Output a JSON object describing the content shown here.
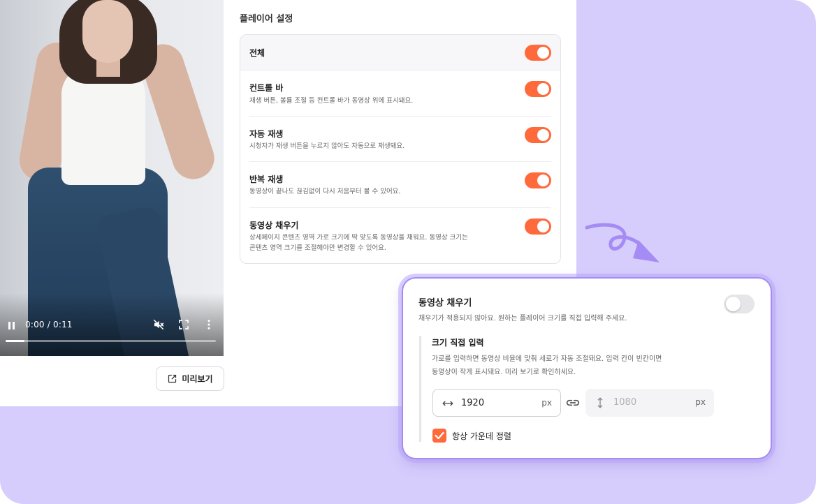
{
  "colors": {
    "accent": "#ff6a3d",
    "purple_bg": "#d6cdfd",
    "popup_glow": "#a58cf4"
  },
  "video": {
    "time": "0:00 / 0:11",
    "progress": 0.09,
    "icons": [
      "pause-icon",
      "mute-icon",
      "fullscreen-icon",
      "more-vertical-icon"
    ]
  },
  "preview": {
    "label": "미리보기",
    "icon": "external-link-icon"
  },
  "settings": {
    "title": "플레이어 설정",
    "all": {
      "label": "전체",
      "on": true
    },
    "rows": [
      {
        "title": "컨트롤 바",
        "desc": "재생 버튼, 볼륨 조절 등 컨트롤 바가 동영상 위에 표시돼요.",
        "on": true
      },
      {
        "title": "자동 재생",
        "desc": "시청자가 재생 버튼을 누르지 않아도 자동으로 재생돼요.",
        "on": true
      },
      {
        "title": "반복 재생",
        "desc": "동영상이 끝나도 끊김없이 다시 처음부터 볼 수 있어요.",
        "on": true
      },
      {
        "title": "동영상 채우기",
        "desc_line1": "상세페이지 콘텐츠 영역 가로 크기에 딱 맞도록 동영상을 채워요. 동영상 크기는",
        "desc_line2": "콘텐츠 영역 크기를 조절해야만 변경할 수 있어요.",
        "on": true
      }
    ]
  },
  "popup": {
    "title": "동영상 채우기",
    "desc": "채우기가 적용되지 않아요. 원하는 플레이어 크기를 직접 입력해 주세요.",
    "toggle_on": false,
    "sub_title": "크기 직접 입력",
    "sub_desc_line1": "가로를 입력하면 동영상 비율에 맞춰 세로가 자동 조절돼요. 입력 칸이 빈칸이면",
    "sub_desc_line2": "동영상이 작게 표시돼요. 미리 보기로 확인하세요.",
    "width": {
      "value": "1920",
      "unit": "px",
      "icon": "horizontal-arrows-icon"
    },
    "height": {
      "value": "1080",
      "unit": "px",
      "icon": "vertical-arrows-icon"
    },
    "link_icon": "link-icon",
    "checkbox": {
      "label": "항상 가운데 정렬",
      "checked": true
    }
  }
}
